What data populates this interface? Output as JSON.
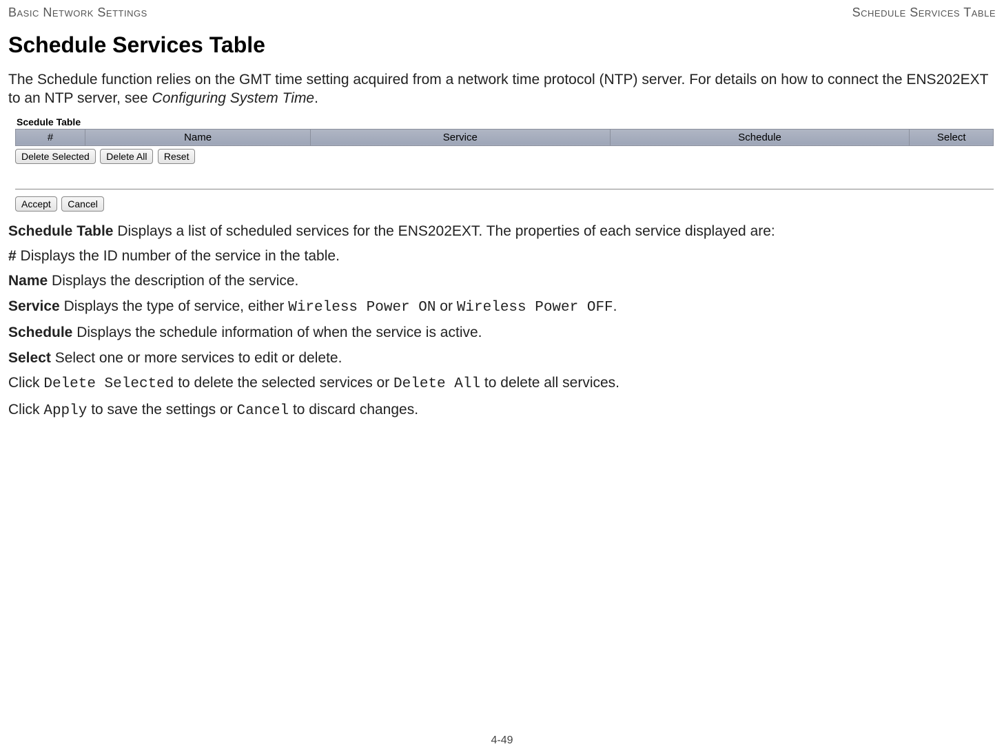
{
  "header": {
    "left": "Basic Network Settings",
    "right": "Schedule Services Table"
  },
  "title": "Schedule Services Table",
  "intro_part1": "The Schedule function relies on the GMT time setting acquired from a network time protocol (NTP) server. For details on how to connect the ENS202EXT to an NTP server, see ",
  "intro_italic": "Configuring System Time",
  "intro_part2": ".",
  "screenshot": {
    "box_label": "Scedule Table",
    "columns": {
      "num": "#",
      "name": "Name",
      "service": "Service",
      "schedule": "Schedule",
      "select": "Select"
    },
    "buttons_top": {
      "delete_selected": "Delete Selected",
      "delete_all": "Delete All",
      "reset": "Reset"
    },
    "buttons_bottom": {
      "accept": "Accept",
      "cancel": "Cancel"
    }
  },
  "descriptions": {
    "schedule_table": {
      "term": "Schedule Table",
      "text": " Displays a list of scheduled services for the ENS202EXT. The properties of each service displayed are:"
    },
    "hash": {
      "term": "#",
      "text": " Displays the ID number of the service in the table."
    },
    "name": {
      "term": "Name",
      "text": " Displays the description of the service."
    },
    "service": {
      "term": "Service",
      "text1": " Displays the type of service, either ",
      "code1": "Wireless Power ON",
      "text2": " or ",
      "code2": "Wireless Power OFF",
      "text3": "."
    },
    "schedule": {
      "term": "Schedule",
      "text": " Displays the schedule information of when the service is active."
    },
    "select": {
      "term": "Select",
      "text": "  Select one or more services to edit or delete."
    },
    "click1": {
      "text1": "Click ",
      "code1": "Delete Selected",
      "text2": " to delete the selected services or ",
      "code2": "Delete All",
      "text3": " to delete all services."
    },
    "click2": {
      "text1": "Click ",
      "code1": "Apply",
      "text2": " to save the settings or ",
      "code2": "Cancel",
      "text3": " to discard changes."
    }
  },
  "footer": "4-49"
}
